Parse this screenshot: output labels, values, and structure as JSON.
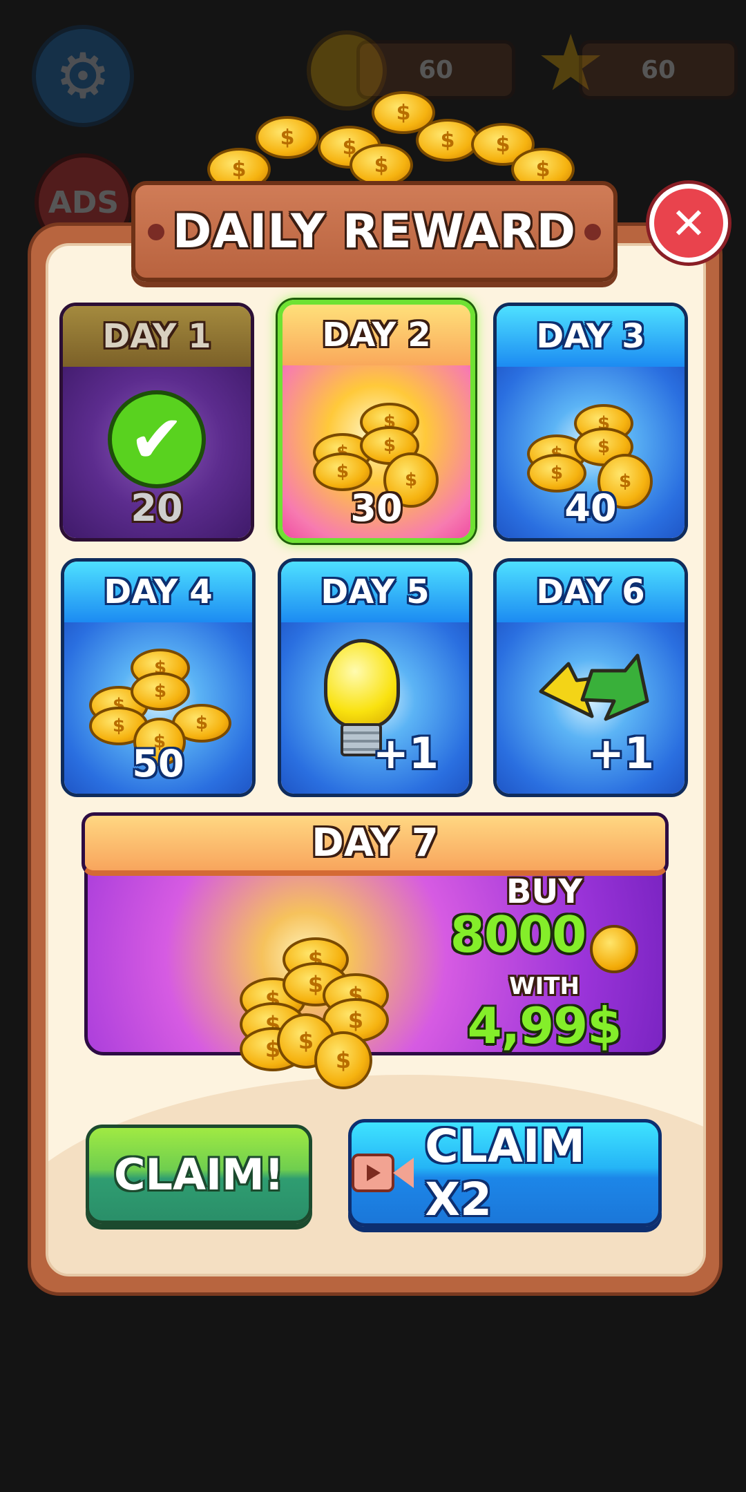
{
  "hud": {
    "coins_value": "60",
    "stars_value": "60",
    "ads_label": "ADS"
  },
  "dialog": {
    "title": "DAILY REWARD",
    "close_label": "✕"
  },
  "days": [
    {
      "title": "DAY 1",
      "amount": "20",
      "state": "claimed",
      "icon": "check-icon"
    },
    {
      "title": "DAY 2",
      "amount": "30",
      "state": "current",
      "icon": "coin-stack-icon"
    },
    {
      "title": "DAY 3",
      "amount": "40",
      "state": "locked",
      "icon": "coin-stack-icon"
    },
    {
      "title": "DAY 4",
      "amount": "50",
      "state": "locked",
      "icon": "coin-stack-icon"
    },
    {
      "title": "DAY 5",
      "amount": "+1",
      "state": "locked",
      "icon": "lightbulb-icon"
    },
    {
      "title": "DAY 6",
      "amount": "+1",
      "state": "locked",
      "icon": "swap-arrows-icon"
    }
  ],
  "day7": {
    "title": "DAY 7",
    "buy_label": "BUY",
    "coin_amount": "8000",
    "with_label": "WITH",
    "price": "4,99$"
  },
  "buttons": {
    "claim_label": "CLAIM!",
    "claim_x2_label": "CLAIM X2"
  },
  "colors": {
    "accent_green": "#84ee2a",
    "panel_brown": "#b8653f",
    "card_blue": "#2a6fe0"
  }
}
